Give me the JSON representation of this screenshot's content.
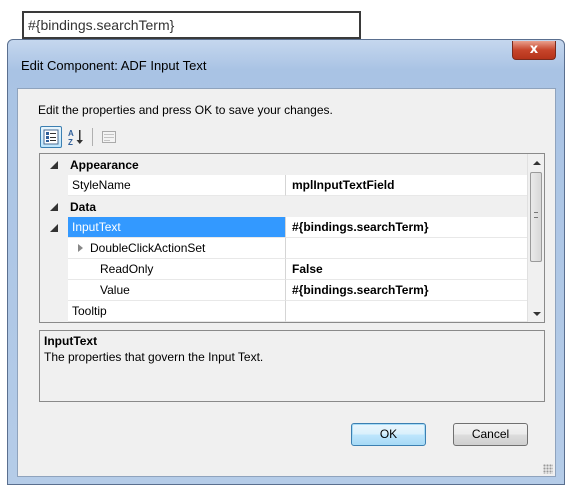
{
  "background_field": {
    "value": "#{bindings.searchTerm}"
  },
  "window": {
    "title": "Edit Component: ADF Input Text",
    "close_glyph": "x",
    "instructions": "Edit the properties and press OK to save your changes."
  },
  "toolbar": {
    "items": [
      {
        "icon": "categorized-view-icon",
        "active": true
      },
      {
        "icon": "alphabetical-sort-icon",
        "active": false
      },
      {
        "icon": "property-pages-icon",
        "active": false
      }
    ]
  },
  "property_grid": {
    "categories": [
      {
        "label": "Appearance"
      },
      {
        "label": "Data"
      }
    ],
    "rows": [
      {
        "name": "StyleName",
        "value": "mplInputTextField"
      },
      {
        "name": "InputText",
        "value": "#{bindings.searchTerm}",
        "selected": true
      },
      {
        "name": "DoubleClickActionSet",
        "value": ""
      },
      {
        "name": "ReadOnly",
        "value": "False"
      },
      {
        "name": "Value",
        "value": "#{bindings.searchTerm}"
      },
      {
        "name": "Tooltip",
        "value": ""
      }
    ]
  },
  "description": {
    "title": "InputText",
    "text": "The properties that govern the Input Text."
  },
  "buttons": {
    "ok": "OK",
    "cancel": "Cancel"
  },
  "colors": {
    "selection": "#3399ff",
    "close_button": "#c7452b",
    "title_bar": "#b5cce8"
  }
}
